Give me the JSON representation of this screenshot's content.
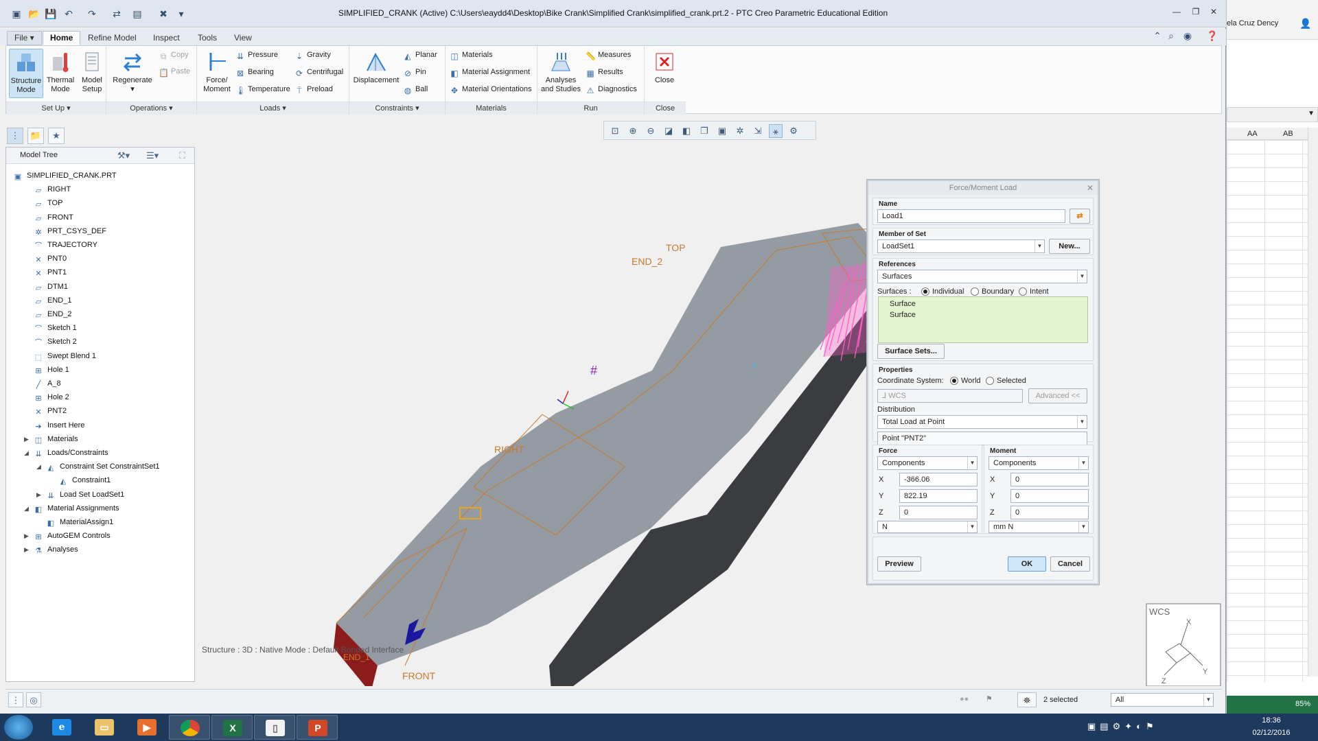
{
  "window": {
    "title": "SIMPLIFIED_CRANK (Active) C:\\Users\\eaydd4\\Desktop\\Bike Crank\\Simplified Crank\\simplified_crank.prt.2 - PTC Creo Parametric Educational Edition",
    "user": "ela Cruz Dency"
  },
  "tabs": [
    "File",
    "Home",
    "Refine Model",
    "Inspect",
    "Tools",
    "View"
  ],
  "ribbon": {
    "setup": {
      "label": "Set Up",
      "structure": "Structure\nMode",
      "thermal": "Thermal\nMode",
      "model_setup": "Model\nSetup"
    },
    "operations": {
      "label": "Operations",
      "regenerate": "Regenerate",
      "copy": "Copy",
      "paste": "Paste"
    },
    "loads": {
      "label": "Loads",
      "force": "Force/\nMoment",
      "pressure": "Pressure",
      "bearing": "Bearing",
      "temperature": "Temperature",
      "gravity": "Gravity",
      "centrifugal": "Centrifugal",
      "preload": "Preload"
    },
    "constraints": {
      "label": "Constraints",
      "displacement": "Displacement",
      "planar": "Planar",
      "pin": "Pin",
      "ball": "Ball"
    },
    "materials": {
      "label": "Materials",
      "materials": "Materials",
      "assignment": "Material Assignment",
      "orientations": "Material Orientations"
    },
    "run": {
      "label": "Run",
      "analyses": "Analyses\nand Studies",
      "measures": "Measures",
      "results": "Results",
      "diagnostics": "Diagnostics"
    },
    "close": {
      "label": "Close",
      "close": "Close"
    }
  },
  "model_tree": {
    "title": "Model Tree",
    "items": [
      {
        "label": "SIMPLIFIED_CRANK.PRT",
        "icon": "part-icon",
        "level": 0,
        "expander": ""
      },
      {
        "label": "RIGHT",
        "icon": "datum-plane-icon",
        "level": 1,
        "expander": ""
      },
      {
        "label": "TOP",
        "icon": "datum-plane-icon",
        "level": 1,
        "expander": ""
      },
      {
        "label": "FRONT",
        "icon": "datum-plane-icon",
        "level": 1,
        "expander": ""
      },
      {
        "label": "PRT_CSYS_DEF",
        "icon": "csys-icon",
        "level": 1,
        "expander": ""
      },
      {
        "label": "TRAJECTORY",
        "icon": "sketch-icon",
        "level": 1,
        "expander": ""
      },
      {
        "label": "PNT0",
        "icon": "datum-point-icon",
        "level": 1,
        "expander": ""
      },
      {
        "label": "PNT1",
        "icon": "datum-point-icon",
        "level": 1,
        "expander": ""
      },
      {
        "label": "DTM1",
        "icon": "datum-plane-icon",
        "level": 1,
        "expander": ""
      },
      {
        "label": "END_1",
        "icon": "datum-plane-icon",
        "level": 1,
        "expander": ""
      },
      {
        "label": "END_2",
        "icon": "datum-plane-icon",
        "level": 1,
        "expander": ""
      },
      {
        "label": "Sketch 1",
        "icon": "sketch-icon",
        "level": 1,
        "expander": ""
      },
      {
        "label": "Sketch 2",
        "icon": "sketch-icon",
        "level": 1,
        "expander": ""
      },
      {
        "label": "Swept Blend 1",
        "icon": "swept-blend-icon",
        "level": 1,
        "expander": ""
      },
      {
        "label": "Hole 1",
        "icon": "hole-icon",
        "level": 1,
        "expander": ""
      },
      {
        "label": "A_8",
        "icon": "datum-axis-icon",
        "level": 1,
        "expander": ""
      },
      {
        "label": "Hole 2",
        "icon": "hole-icon",
        "level": 1,
        "expander": ""
      },
      {
        "label": "PNT2",
        "icon": "datum-point-icon",
        "level": 1,
        "expander": ""
      },
      {
        "label": "Insert Here",
        "icon": "insert-arrow-icon",
        "level": 1,
        "expander": ""
      },
      {
        "label": "Materials",
        "icon": "materials-icon",
        "level": 1,
        "expander": "▶"
      },
      {
        "label": "Loads/Constraints",
        "icon": "loads-icon",
        "level": 1,
        "expander": "◢"
      },
      {
        "label": "Constraint Set ConstraintSet1",
        "icon": "constraint-set-icon",
        "level": 2,
        "expander": "◢"
      },
      {
        "label": "Constraint1",
        "icon": "constraint-icon",
        "level": 3,
        "expander": ""
      },
      {
        "label": "Load Set LoadSet1",
        "icon": "load-set-icon",
        "level": 2,
        "expander": "▶"
      },
      {
        "label": "Material Assignments",
        "icon": "material-assign-icon",
        "level": 1,
        "expander": "◢"
      },
      {
        "label": "MaterialAssign1",
        "icon": "material-assign-icon",
        "level": 2,
        "expander": ""
      },
      {
        "label": "AutoGEM Controls",
        "icon": "autogem-icon",
        "level": 1,
        "expander": "▶"
      },
      {
        "label": "Analyses",
        "icon": "analyses-icon",
        "level": 1,
        "expander": "▶"
      }
    ]
  },
  "viewport": {
    "status": "Structure : 3D : Native Mode : Default Bonded Interface",
    "labels": {
      "top": "TOP",
      "end2": "END_2",
      "right": "RIGHT",
      "front": "FRONT",
      "end1": "END_1",
      "wcs": "WCS",
      "x": "X",
      "y": "Y",
      "z": "Z"
    }
  },
  "dialog": {
    "title": "Force/Moment Load",
    "name_label": "Name",
    "name_value": "Load1",
    "set_label": "Member of Set",
    "set_value": "LoadSet1",
    "new_btn": "New...",
    "refs_label": "References",
    "refs_value": "Surfaces",
    "surfaces_label": "Surfaces :",
    "opt_individual": "Individual",
    "opt_boundary": "Boundary",
    "opt_intent": "Intent",
    "surface_list": [
      "Surface",
      "Surface"
    ],
    "surface_sets_btn": "Surface Sets...",
    "props_label": "Properties",
    "csys_label": "Coordinate System:",
    "opt_world": "World",
    "opt_selected": "Selected",
    "csys_value": "WCS",
    "advanced_btn": "Advanced <<",
    "dist_label": "Distribution",
    "dist_value": "Total Load at Point",
    "point_value": "Point \"PNT2\"",
    "force_label": "Force",
    "force_mode": "Components",
    "fx": "-366.06",
    "fy": "822.19",
    "fz": "0",
    "force_unit": "N",
    "moment_label": "Moment",
    "moment_mode": "Components",
    "mx": "0",
    "my": "0",
    "mz": "0",
    "moment_unit": "mm N",
    "axis_x": "X",
    "axis_y": "Y",
    "axis_z": "Z",
    "preview_btn": "Preview",
    "ok_btn": "OK",
    "cancel_btn": "Cancel"
  },
  "statusbar": {
    "selected": "2 selected",
    "filter": "All"
  },
  "excel": {
    "col_aa": "AA",
    "col_ab": "AB",
    "zoom": "85%"
  },
  "taskbar": {
    "time": "18:36",
    "date": "02/12/2016"
  },
  "colors": {
    "ribbon_accent": "#cde4f7",
    "surface_list": "#e4f3d0",
    "load_arrows": "#ff5cc8",
    "crank_light": "#959ba3",
    "crank_dark": "#3a3c40",
    "datum": "#c77a2b"
  }
}
